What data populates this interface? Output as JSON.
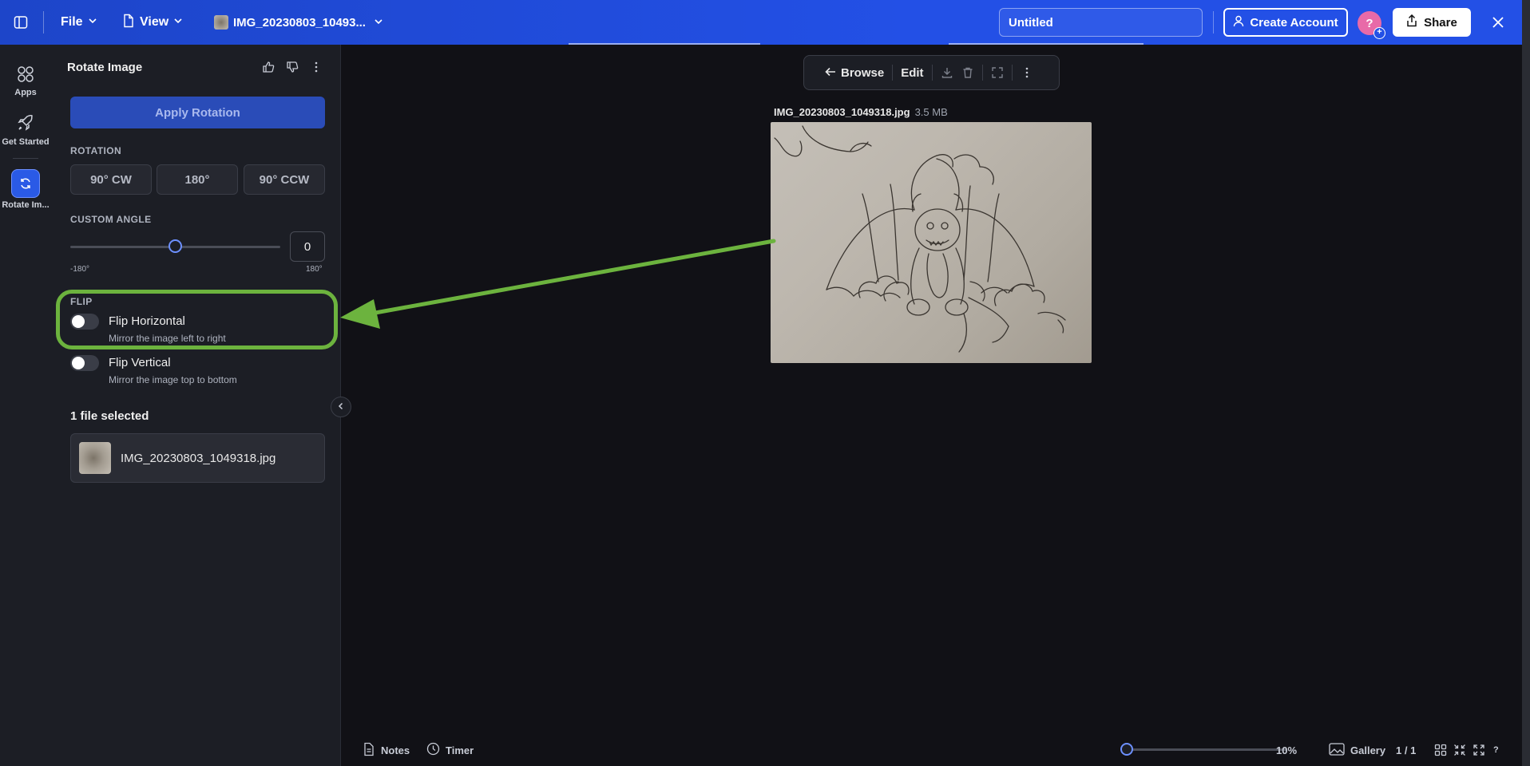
{
  "topbar": {
    "file_label": "File",
    "view_label": "View",
    "doc_tab_label": "IMG_20230803_10493...",
    "title_value": "Untitled",
    "create_account_label": "Create Account",
    "avatar_letter": "?",
    "avatar_badge": "+",
    "share_label": "Share"
  },
  "rail": {
    "items": [
      {
        "label": "Apps",
        "icon": "grid-icon"
      },
      {
        "label": "Get Started",
        "icon": "rocket-icon"
      },
      {
        "label": "Rotate Im...",
        "icon": "rotate-icon"
      }
    ]
  },
  "panel": {
    "title": "Rotate Image",
    "apply_label": "Apply Rotation",
    "rotation_label": "ROTATION",
    "rotation_options": [
      "90° CW",
      "180°",
      "90° CCW"
    ],
    "custom_angle_label": "CUSTOM ANGLE",
    "angle_value": "0",
    "angle_min": "-180°",
    "angle_max": "180°",
    "angle_slider_value": 0,
    "angle_slider_range": [
      -180,
      180
    ],
    "flip_label": "FLIP",
    "flip_horizontal_title": "Flip Horizontal",
    "flip_horizontal_desc": "Mirror the image left to right",
    "flip_vertical_title": "Flip Vertical",
    "flip_vertical_desc": "Mirror the image top to bottom",
    "files_selected": "1 file selected",
    "file_name": "IMG_20230803_1049318.jpg"
  },
  "viewer": {
    "browse_label": "Browse",
    "edit_label": "Edit",
    "image_name": "IMG_20230803_1049318.jpg",
    "image_size": "3.5 MB"
  },
  "bottombar": {
    "notes_label": "Notes",
    "timer_label": "Timer",
    "zoom_value": "10%",
    "gallery_label": "Gallery",
    "page_indicator": "1 / 1",
    "help_label": "?"
  },
  "colors": {
    "accent": "#2350e6",
    "highlight": "#6cb33e",
    "panel_bg": "#1c1e25",
    "canvas_bg": "#111116"
  }
}
